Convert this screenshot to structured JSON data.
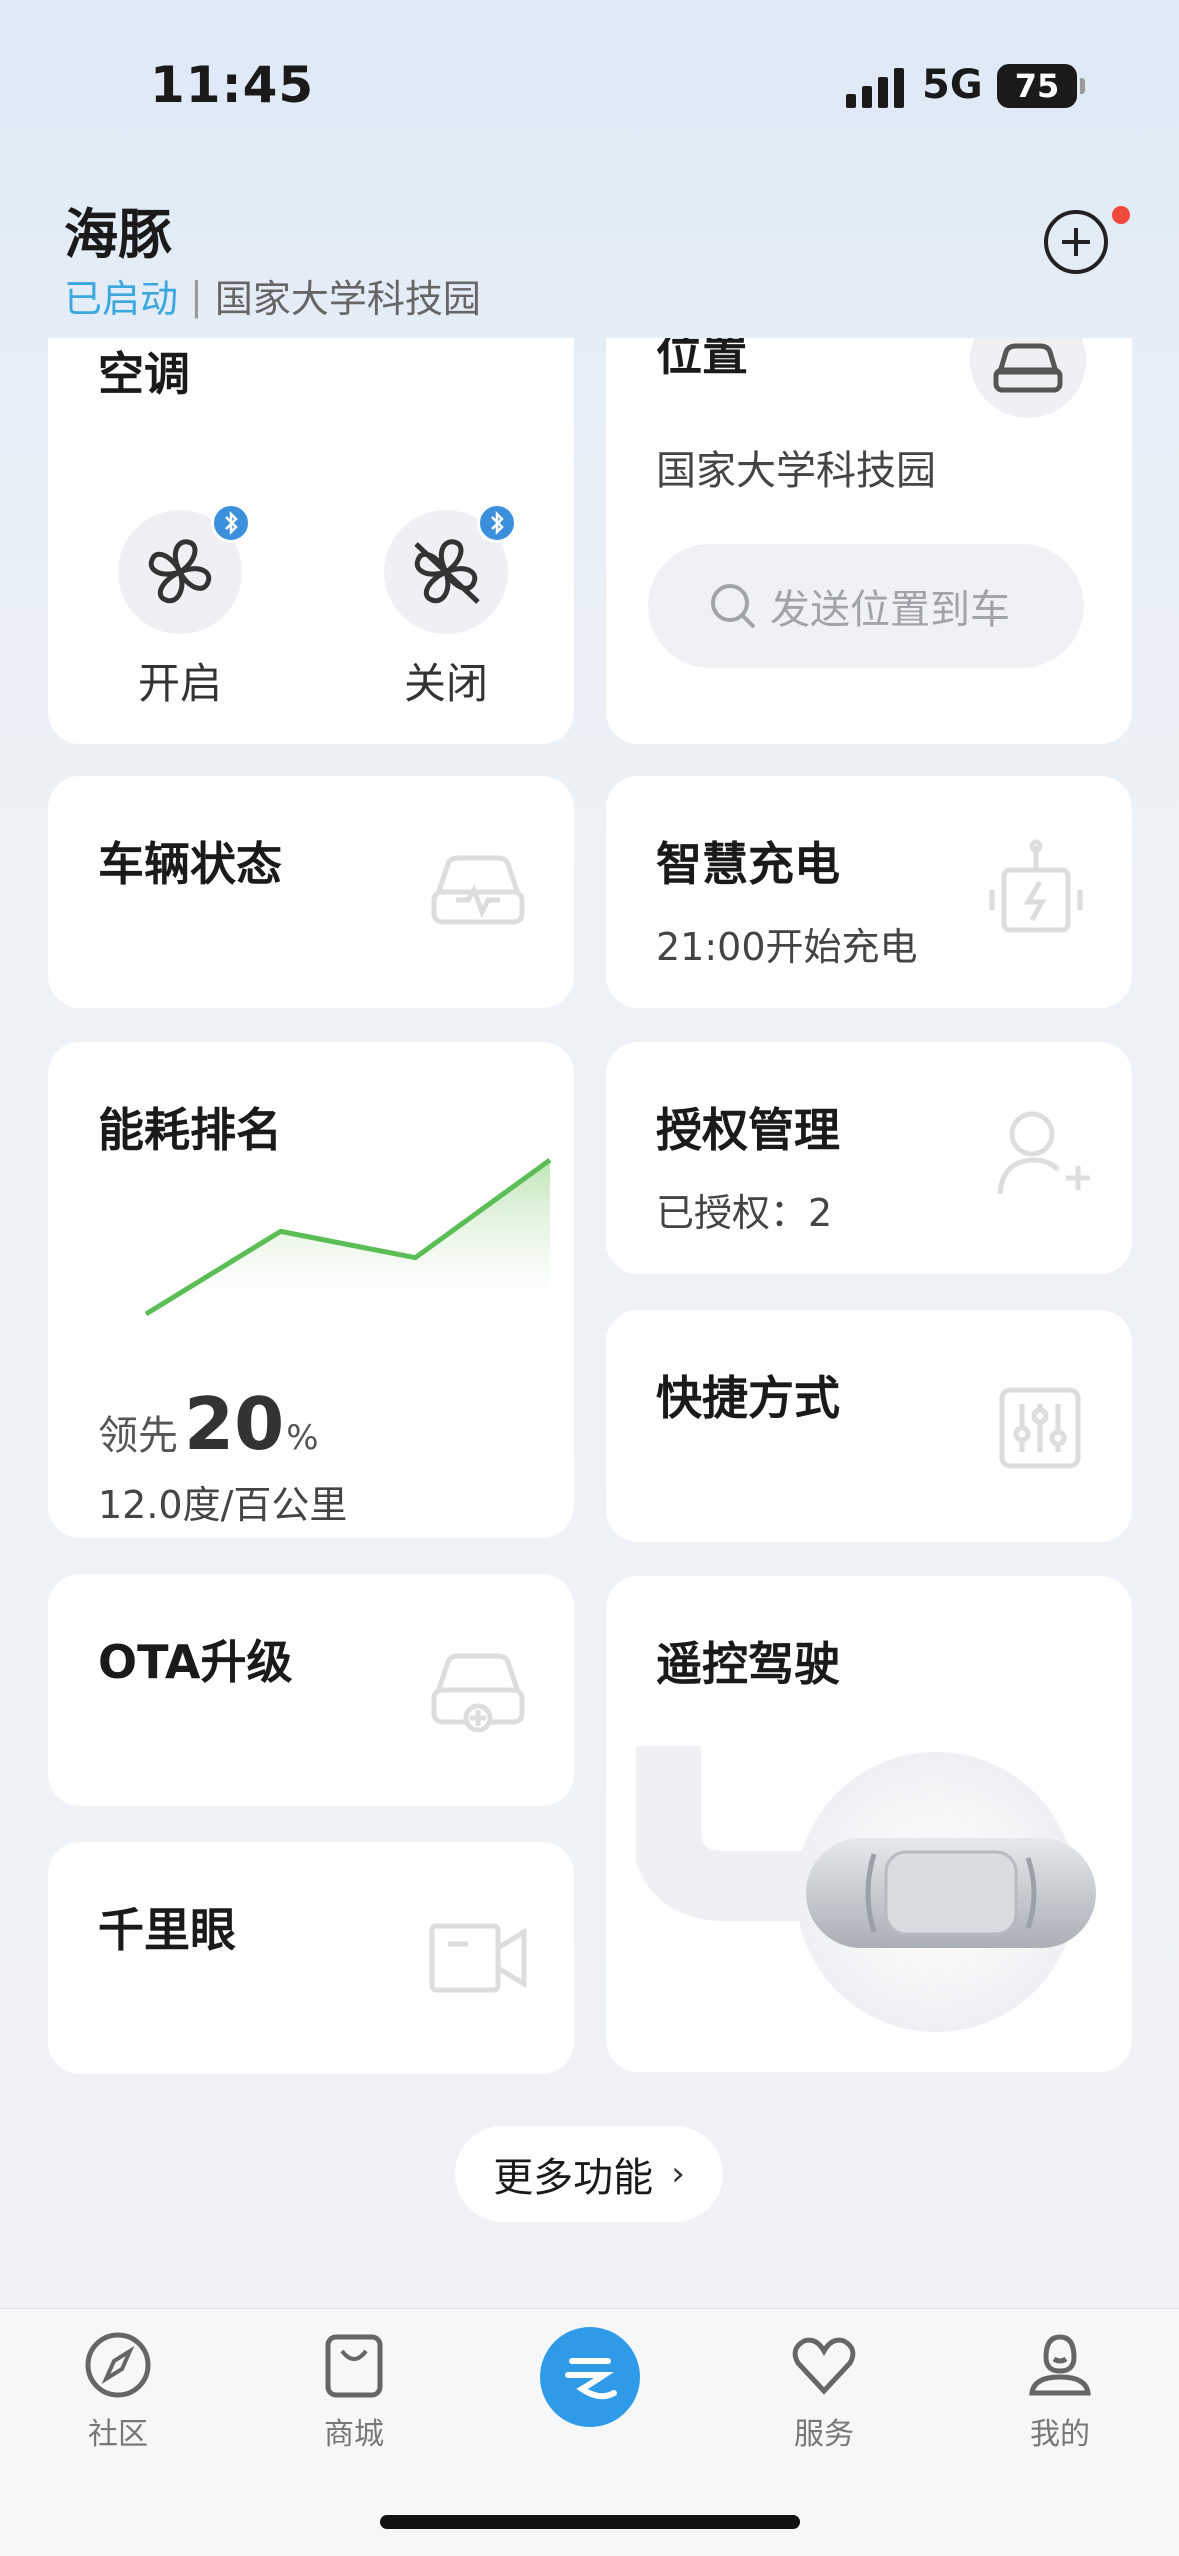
{
  "status_bar": {
    "time": "11:45",
    "network": "5G",
    "battery": "75"
  },
  "header": {
    "title": "海豚",
    "status": "已启动",
    "separator": "|",
    "location": "国家大学科技园"
  },
  "cards": {
    "aircon": {
      "title": "空调",
      "on_label": "开启",
      "off_label": "关闭"
    },
    "position": {
      "title": "位置",
      "address": "国家大学科技园",
      "search_placeholder": "发送位置到车"
    },
    "vehicle_status": {
      "title": "车辆状态"
    },
    "smart_charge": {
      "title": "智慧充电",
      "subtitle": "21:00开始充电"
    },
    "energy_rank": {
      "title": "能耗排名",
      "lead_prefix": "领先",
      "lead_value": "20",
      "lead_unit": "%",
      "consumption": "12.0度/百公里"
    },
    "authorization": {
      "title": "授权管理",
      "subtitle": "已授权：2"
    },
    "shortcuts": {
      "title": "快捷方式"
    },
    "ota": {
      "title": "OTA升级"
    },
    "remote_drive": {
      "title": "遥控驾驶"
    },
    "camera": {
      "title": "千里眼"
    }
  },
  "more_button": {
    "label": "更多功能",
    "chevron": "›"
  },
  "tabs": [
    {
      "label": "社区",
      "icon": "compass-icon"
    },
    {
      "label": "商城",
      "icon": "shopping-bag-icon"
    },
    {
      "label": "",
      "icon": "home-logo-icon"
    },
    {
      "label": "服务",
      "icon": "heart-icon"
    },
    {
      "label": "我的",
      "icon": "profile-icon"
    }
  ],
  "chart_data": {
    "type": "area",
    "x": [
      0,
      1,
      2,
      3
    ],
    "values": [
      0,
      2.2,
      1.5,
      4.1
    ],
    "title": "",
    "xlabel": "",
    "ylabel": "",
    "colors": {
      "line": "#5bbd55",
      "fill": "#bfe5b6"
    }
  },
  "colors": {
    "accent": "#3aa7dd",
    "brand": "#2f9be8",
    "badge": "#f04a3f",
    "chart_line": "#5bbd55"
  }
}
